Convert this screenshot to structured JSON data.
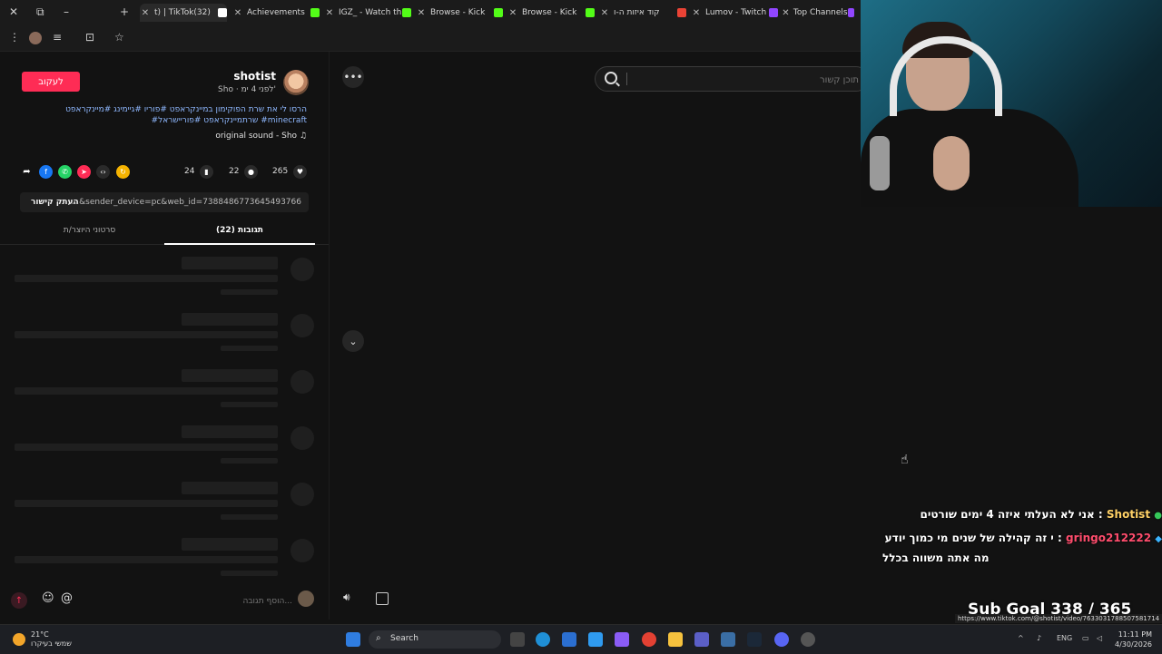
{
  "tabs": [
    {
      "label": "t) | TikTok(32)",
      "color": "#ffffff"
    },
    {
      "label": "Achievements",
      "color": "#53fc18"
    },
    {
      "label": "IGZ_ - Watch th",
      "color": "#53fc18"
    },
    {
      "label": "Browse - Kick",
      "color": "#53fc18"
    },
    {
      "label": "Browse - Kick",
      "color": "#53fc18"
    },
    {
      "label": "קוד איזות ה-ו",
      "color": "#ea4335"
    },
    {
      "label": "Lumov - Twitch",
      "color": "#9146ff"
    },
    {
      "label": "Top Channels",
      "color": "#9146ff"
    }
  ],
  "post": {
    "follow_label": "לעקוב",
    "username": "shotist",
    "subline": "Sho · לפני 4 ימ'",
    "desc_line1": "הרסו לי את שרת הפוקימון במיינקראפט #פוריו #גיימינג #מיינקראפט",
    "desc_line2": "#שרתמיינקראפט #פוריישראל #minecraft",
    "sound": "original sound - Sho",
    "bookmarks": "24",
    "comments": "22",
    "likes": "265",
    "copy_link_label": "העתק קישור",
    "link_url": "...&sender_device=pc&web_id=7388486773645493766",
    "tab_comments": "תגובות (22)",
    "tab_creator_videos": "סרטוני היוצר/ת",
    "comment_placeholder": "הוסף תגובה..."
  },
  "search": {
    "placeholder": "תוכן קשור"
  },
  "chat": [
    {
      "user": "Shotist",
      "message": "אני לא העלתי איזה 4 ימים שורטים"
    },
    {
      "user": "gringo212222",
      "message": "י זה קהילה של שנים מי כמוך יודע",
      "continuation": "מה אתה משווה בכלל"
    }
  ],
  "overlay": {
    "sub_goal": "Sub Goal 338 / 365",
    "status_url": "https://www.tiktok.com/@shotist/video/7633031788507581714"
  },
  "taskbar": {
    "temp": "21°C",
    "weather": "שמשי בעיקרו",
    "search_label": "Search",
    "lang": "ENG",
    "time": "11:11 PM",
    "date": "4/30/2026"
  }
}
